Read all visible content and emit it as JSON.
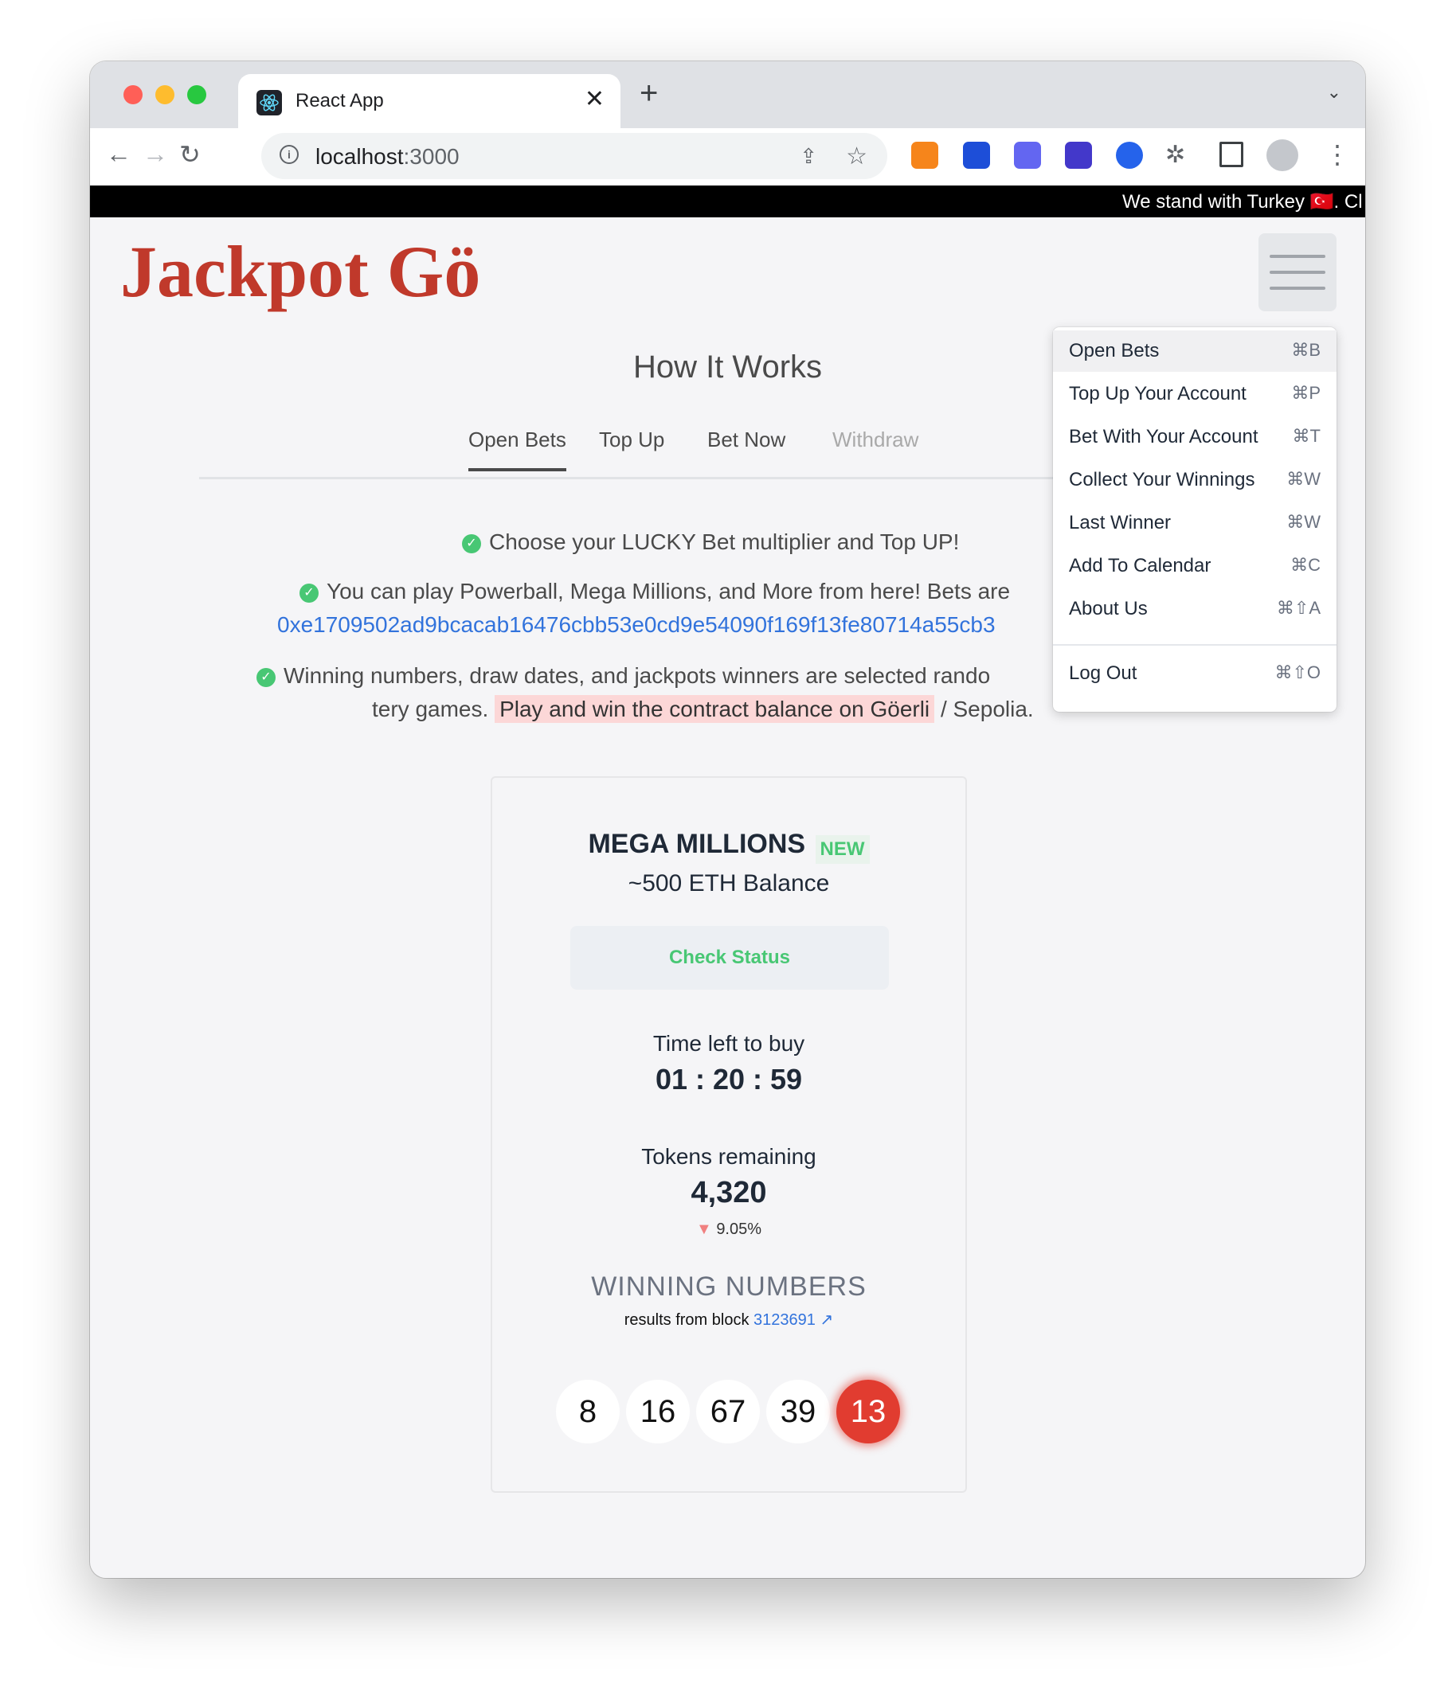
{
  "browser": {
    "tab_title": "React App",
    "url_host": "localhost",
    "url_port": ":3000"
  },
  "banner": {
    "text": "We stand with Turkey 🇹🇷. Cl"
  },
  "logo": "Jackpot Gö",
  "how_it_works": {
    "title": "How It Works",
    "tabs": [
      "Open Bets",
      "Top Up",
      "Bet Now",
      "Withdraw"
    ],
    "line1": "Choose your LUCKY Bet multiplier and Top UP!",
    "line2": "You can play Powerball, Mega Millions, and More from here! Bets are",
    "address": "0xe1709502ad9bcacab16476cbb53e0cd9e54090f169f13fe80714a55cb3",
    "line3": "Winning numbers, draw dates, and jackpots winners are selected rando",
    "line4_prefix": "tery games.",
    "line4_highlight": "Play and win the contract balance on Göerli",
    "line4_suffix": "/ Sepolia."
  },
  "card": {
    "title": "MEGA MILLIONS",
    "badge": "NEW",
    "balance": "~500 ETH Balance",
    "check_status": "Check Status",
    "time_label": "Time left to buy",
    "time_value": "01 : 20 : 59",
    "tokens_label": "Tokens remaining",
    "tokens_value": "4,320",
    "tokens_change": "9.05%",
    "winning_title": "WINNING NUMBERS",
    "results_prefix": "results from block",
    "block": "3123691",
    "numbers": [
      "8",
      "16",
      "67",
      "39",
      "13"
    ]
  },
  "menu": {
    "items": [
      {
        "label": "Open Bets",
        "shortcut": "⌘B"
      },
      {
        "label": "Top Up Your Account",
        "shortcut": "⌘P"
      },
      {
        "label": "Bet With Your Account",
        "shortcut": "⌘T"
      },
      {
        "label": "Collect Your Winnings",
        "shortcut": "⌘W"
      },
      {
        "label": "Last Winner",
        "shortcut": "⌘W"
      },
      {
        "label": "Add To Calendar",
        "shortcut": "⌘C"
      },
      {
        "label": "About Us",
        "shortcut": "⌘⇧A"
      },
      {
        "label": "Log Out",
        "shortcut": "⌘⇧O"
      }
    ]
  },
  "colors": {
    "brand": "#c0392b",
    "success": "#48c774",
    "link": "#3273dc",
    "ball_highlight": "#e13c30"
  }
}
